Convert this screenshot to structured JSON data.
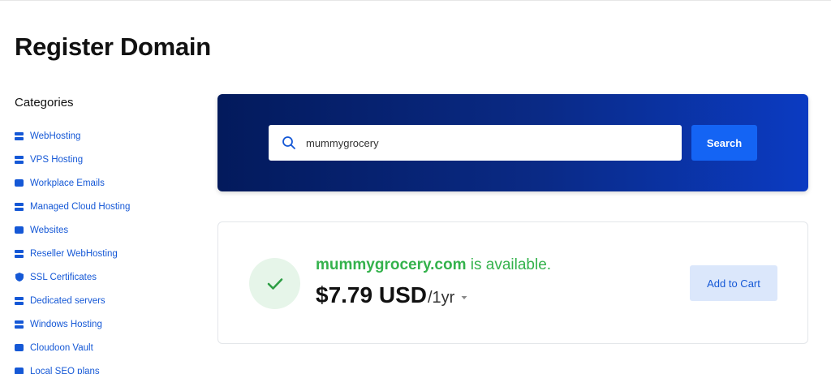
{
  "page": {
    "title": "Register Domain"
  },
  "sidebar": {
    "heading": "Categories",
    "items": [
      {
        "label": "WebHosting",
        "icon": "server-icon"
      },
      {
        "label": "VPS Hosting",
        "icon": "server-icon"
      },
      {
        "label": "Workplace Emails",
        "icon": "email-icon"
      },
      {
        "label": "Managed Cloud Hosting",
        "icon": "server-icon"
      },
      {
        "label": "Websites",
        "icon": "website-icon"
      },
      {
        "label": "Reseller WebHosting",
        "icon": "server-icon"
      },
      {
        "label": "SSL Certificates",
        "icon": "shield-icon"
      },
      {
        "label": "Dedicated servers",
        "icon": "server-icon"
      },
      {
        "label": "Windows Hosting",
        "icon": "server-icon"
      },
      {
        "label": "Cloudoon Vault",
        "icon": "vault-icon"
      },
      {
        "label": "Local SEO plans",
        "icon": "seo-icon"
      }
    ]
  },
  "search": {
    "value": "mummygrocery",
    "button_label": "Search"
  },
  "result": {
    "domain": "mummygrocery.com",
    "status_text": " is available.",
    "price": "$7.79 USD",
    "period": "/1yr",
    "add_to_cart_label": "Add to Cart"
  },
  "colors": {
    "accent": "#1464f4",
    "link": "#1558d6",
    "available_green": "#34b24c",
    "panel_dark": "#031a5c"
  }
}
